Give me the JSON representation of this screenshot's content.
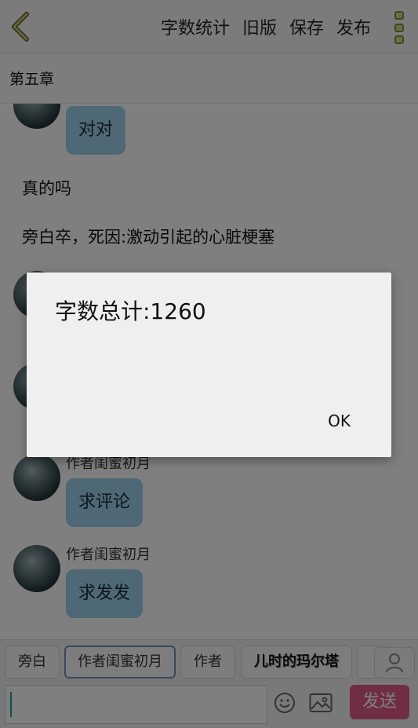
{
  "topbar": {
    "back_icon": "chevron-left-icon",
    "actions": [
      "字数统计",
      "旧版",
      "保存",
      "发布"
    ],
    "more_icon": "more-vertical-icon"
  },
  "chapter": {
    "title": "第五章"
  },
  "messages": {
    "m1_text": "对对",
    "narration1": "真的吗",
    "narration2": "旁白卒，死因:激动引起的心脏梗塞",
    "m4_author": "作者闺蜜初月",
    "m4_text": "求评论",
    "m5_author": "作者闺蜜初月",
    "m5_text": "求发发"
  },
  "dialog": {
    "message": "字数总计:1260",
    "ok_label": "OK"
  },
  "roles": [
    "旁白",
    "作者闺蜜初月",
    "作者",
    "儿时的玛尔塔"
  ],
  "input": {
    "placeholder": "",
    "emoji_icon": "emoji-icon",
    "image_icon": "image-icon",
    "send_label": "发送"
  },
  "colors": {
    "bubble": "#9cd0eb",
    "send": "#e25b8b",
    "more_dots": "#d9d89a"
  }
}
